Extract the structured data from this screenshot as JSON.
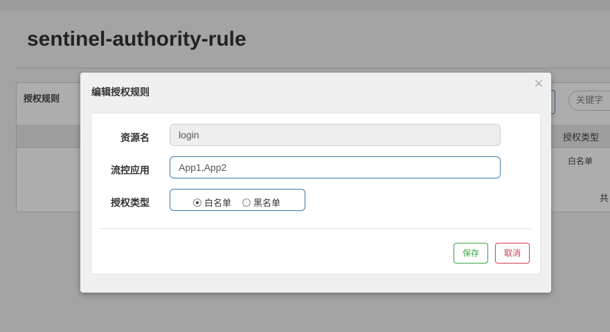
{
  "page": {
    "title": "sentinel-authority-rule",
    "panel_heading": "授权规则",
    "search_placeholder": "关键字",
    "table_header_strategy": "授权类型",
    "row_strategy": "白名单",
    "total_prefix": "共"
  },
  "modal": {
    "title": "编辑授权规则",
    "close_glyph": "×",
    "fields": {
      "resource_label": "资源名",
      "resource_value": "login",
      "limit_app_label": "流控应用",
      "limit_app_value": "App1,App2",
      "strategy_label": "授权类型"
    },
    "strategy_options": [
      {
        "label": "白名单",
        "selected": true
      },
      {
        "label": "黑名单",
        "selected": false
      }
    ],
    "buttons": {
      "save": "保存",
      "cancel": "取消"
    }
  },
  "colors": {
    "save": "#3aa244",
    "cancel": "#cf3b48",
    "focus_border": "#3d78a8"
  }
}
